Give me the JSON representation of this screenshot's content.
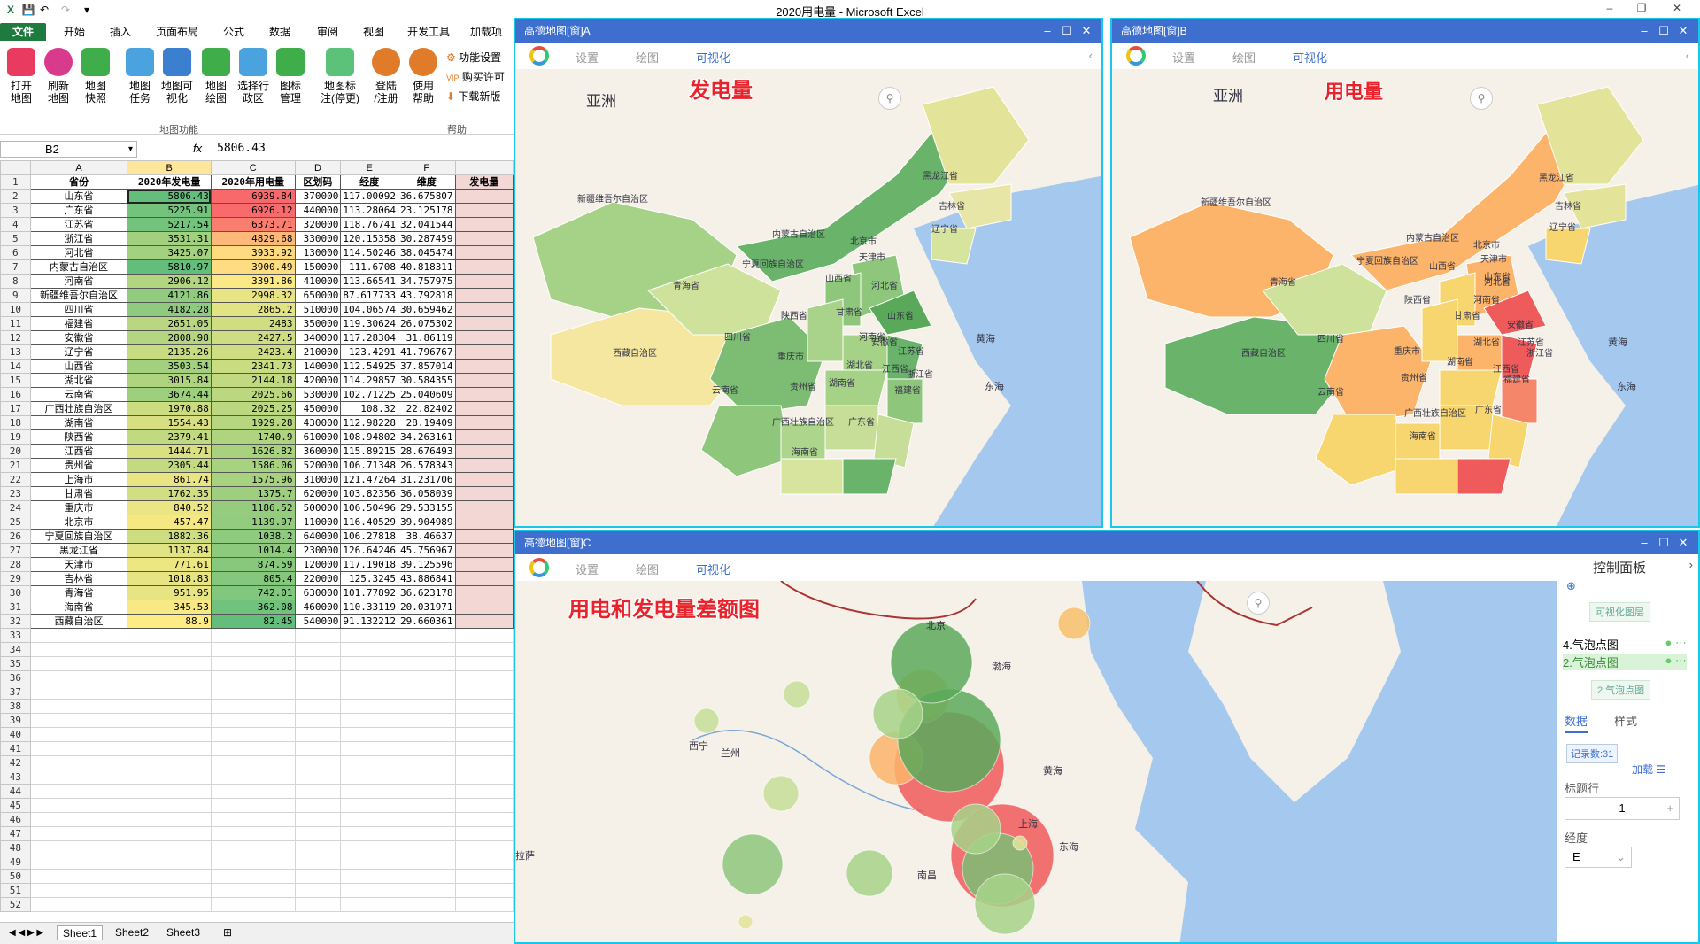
{
  "window": {
    "title": "2020用电量 - Microsoft Excel",
    "controls": [
      "–",
      "❐",
      "✕"
    ]
  },
  "ribbon": {
    "tabs": [
      "文件",
      "开始",
      "插入",
      "页面布局",
      "公式",
      "数据",
      "审阅",
      "视图",
      "开发工具",
      "加载项"
    ],
    "buttons": [
      {
        "l1": "打开",
        "l2": "地图",
        "color": "#e83b5f"
      },
      {
        "l1": "刷新",
        "l2": "地图",
        "color": "#d83b8c"
      },
      {
        "l1": "地图",
        "l2": "快照",
        "color": "#3fae4a"
      },
      {
        "l1": "地图",
        "l2": "任务",
        "color": "#4aa3df"
      },
      {
        "l1": "地图可",
        "l2": "视化",
        "color": "#3b7fd0"
      },
      {
        "l1": "地图",
        "l2": "绘图",
        "color": "#3fae4a"
      },
      {
        "l1": "选择行",
        "l2": "政区",
        "color": "#4aa3df"
      },
      {
        "l1": "图标",
        "l2": "管理",
        "color": "#3fae4a"
      },
      {
        "l1": "地图标",
        "l2": "注(停更)",
        "color": "#5cc27a"
      },
      {
        "l1": "登陆",
        "l2": "/注册",
        "color": "#e07b2a"
      },
      {
        "l1": "使用",
        "l2": "帮助",
        "color": "#e07b2a"
      }
    ],
    "small": [
      "功能设置",
      "购买许可",
      "下载新版"
    ],
    "groups": {
      "map": "地图功能",
      "help": "帮助"
    }
  },
  "formula_bar": {
    "cell": "B2",
    "fx": "fx",
    "value": "5806.43"
  },
  "sheet": {
    "columns": [
      "A",
      "B",
      "C",
      "D",
      "E",
      "F"
    ],
    "header": [
      "省份",
      "2020年发电量",
      "2020年用电量",
      "区划码",
      "经度",
      "维度",
      "发电量"
    ],
    "rows": [
      [
        "山东省",
        "5806.43",
        "6939.84",
        "370000",
        "117.00092",
        "36.675807"
      ],
      [
        "广东省",
        "5225.91",
        "6926.12",
        "440000",
        "113.28064",
        "23.125178"
      ],
      [
        "江苏省",
        "5217.54",
        "6373.71",
        "320000",
        "118.76741",
        "32.041544"
      ],
      [
        "浙江省",
        "3531.31",
        "4829.68",
        "330000",
        "120.15358",
        "30.287459"
      ],
      [
        "河北省",
        "3425.07",
        "3933.92",
        "130000",
        "114.50246",
        "38.045474"
      ],
      [
        "内蒙古自治区",
        "5810.97",
        "3900.49",
        "150000",
        "111.6708",
        "40.818311"
      ],
      [
        "河南省",
        "2906.12",
        "3391.86",
        "410000",
        "113.66541",
        "34.757975"
      ],
      [
        "新疆维吾尔自治区",
        "4121.86",
        "2998.32",
        "650000",
        "87.617733",
        "43.792818"
      ],
      [
        "四川省",
        "4182.28",
        "2865.2",
        "510000",
        "104.06574",
        "30.659462"
      ],
      [
        "福建省",
        "2651.05",
        "2483",
        "350000",
        "119.30624",
        "26.075302"
      ],
      [
        "安徽省",
        "2808.98",
        "2427.5",
        "340000",
        "117.28304",
        "31.86119"
      ],
      [
        "辽宁省",
        "2135.26",
        "2423.4",
        "210000",
        "123.4291",
        "41.796767"
      ],
      [
        "山西省",
        "3503.54",
        "2341.73",
        "140000",
        "112.54925",
        "37.857014"
      ],
      [
        "湖北省",
        "3015.84",
        "2144.18",
        "420000",
        "114.29857",
        "30.584355"
      ],
      [
        "云南省",
        "3674.44",
        "2025.66",
        "530000",
        "102.71225",
        "25.040609"
      ],
      [
        "广西壮族自治区",
        "1970.88",
        "2025.25",
        "450000",
        "108.32",
        "22.82402"
      ],
      [
        "湖南省",
        "1554.43",
        "1929.28",
        "430000",
        "112.98228",
        "28.19409"
      ],
      [
        "陕西省",
        "2379.41",
        "1740.9",
        "610000",
        "108.94802",
        "34.263161"
      ],
      [
        "江西省",
        "1444.71",
        "1626.82",
        "360000",
        "115.89215",
        "28.676493"
      ],
      [
        "贵州省",
        "2305.44",
        "1586.06",
        "520000",
        "106.71348",
        "26.578343"
      ],
      [
        "上海市",
        "861.74",
        "1575.96",
        "310000",
        "121.47264",
        "31.231706"
      ],
      [
        "甘肃省",
        "1762.35",
        "1375.7",
        "620000",
        "103.82356",
        "36.058039"
      ],
      [
        "重庆市",
        "840.52",
        "1186.52",
        "500000",
        "106.50496",
        "29.533155"
      ],
      [
        "北京市",
        "457.47",
        "1139.97",
        "110000",
        "116.40529",
        "39.904989"
      ],
      [
        "宁夏回族自治区",
        "1882.36",
        "1038.2",
        "640000",
        "106.27818",
        "38.46637"
      ],
      [
        "黑龙江省",
        "1137.84",
        "1014.4",
        "230000",
        "126.64246",
        "45.756967"
      ],
      [
        "天津市",
        "771.61",
        "874.59",
        "120000",
        "117.19018",
        "39.125596"
      ],
      [
        "吉林省",
        "1018.83",
        "805.4",
        "220000",
        "125.3245",
        "43.886841"
      ],
      [
        "青海省",
        "951.95",
        "742.01",
        "630000",
        "101.77892",
        "36.623178"
      ],
      [
        "海南省",
        "345.53",
        "362.08",
        "460000",
        "110.33119",
        "20.031971"
      ],
      [
        "西藏自治区",
        "88.9",
        "82.45",
        "540000",
        "91.132212",
        "29.660361"
      ]
    ],
    "tabs": [
      "Sheet1",
      "Sheet2",
      "Sheet3"
    ]
  },
  "panels": {
    "a": {
      "title": "高德地图[窗]A",
      "menu": [
        "设置",
        "绘图",
        "可视化"
      ],
      "overlay": "发电量",
      "continent": "亚洲",
      "sea": [
        "黄海",
        "东海"
      ],
      "labels": [
        "新疆维吾尔自治区",
        "西藏自治区",
        "青海省",
        "四川省",
        "云南省",
        "内蒙古自治区",
        "黑龙江省",
        "吉林省",
        "辽宁省",
        "北京市",
        "天津市",
        "河北省",
        "山西省",
        "陕西省",
        "甘肃省",
        "宁夏回族自治区",
        "河南省",
        "山东省",
        "湖北省",
        "湖南省",
        "江西省",
        "安徽省",
        "江苏省",
        "浙江省",
        "贵州省",
        "重庆市",
        "广西壮族自治区",
        "广东省",
        "福建省",
        "海南省"
      ]
    },
    "b": {
      "title": "高德地图[窗]B",
      "menu": [
        "设置",
        "绘图",
        "可视化"
      ],
      "overlay": "用电量",
      "continent": "亚洲",
      "sea": [
        "黄海",
        "东海"
      ],
      "labels": [
        "新疆维吾尔自治区",
        "西藏自治区",
        "青海省",
        "四川省",
        "云南省",
        "内蒙古自治区",
        "黑龙江省",
        "吉林省",
        "辽宁省",
        "北京市",
        "天津市",
        "河北省",
        "山西省",
        "陕西省",
        "甘肃省",
        "宁夏回族自治区",
        "河南省",
        "山东省",
        "湖北省",
        "湖南省",
        "江西省",
        "安徽省",
        "江苏省",
        "浙江省",
        "贵州省",
        "重庆市",
        "广西壮族自治区",
        "广东省",
        "福建省",
        "海南省"
      ]
    },
    "c": {
      "title": "高德地图[窗]C",
      "menu": [
        "设置",
        "绘图",
        "可视化"
      ],
      "overlay": "用电和发电量差额图",
      "labels": [
        "北京",
        "渤海",
        "黄海",
        "东海",
        "西宁",
        "兰州",
        "拉萨",
        "南昌",
        "上海"
      ]
    }
  },
  "control_panel": {
    "title": "控制面板",
    "layers_btn": "可视化图层",
    "layers": [
      "4.气泡点图",
      "2.气泡点图"
    ],
    "active_layer": "2.气泡点图",
    "tabs": [
      "数据",
      "样式"
    ],
    "records": "记录数:31",
    "load": "加载",
    "title_row_label": "标题行",
    "title_row_value": "1",
    "lng_label": "经度",
    "lng_value": "E"
  },
  "colors": {
    "excel_green": "#1f7a3f",
    "panel_head": "#3e6fcf",
    "panel_border": "#18c7e9",
    "gen_high": "#6db26d",
    "use_high": "#ef5a5a",
    "use_low": "#f7d56f"
  }
}
